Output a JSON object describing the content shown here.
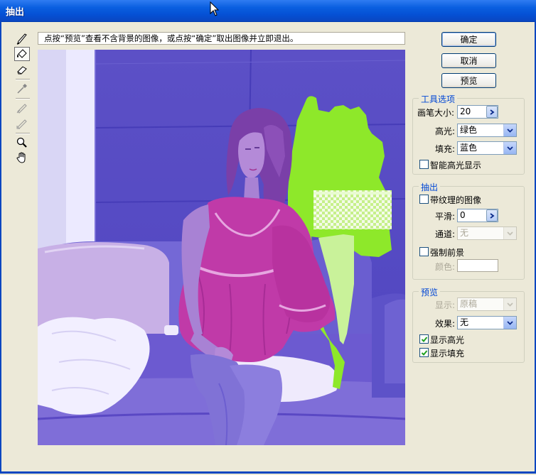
{
  "window": {
    "title": "抽出"
  },
  "instruction": "点按“预览”查看不含背景的图像，或点按“确定”取出图像并立即退出。",
  "buttons": {
    "ok": "确定",
    "cancel": "取消",
    "preview": "预览"
  },
  "tools": [
    {
      "name": "edge-highlighter-tool",
      "icon": "highlighter-icon"
    },
    {
      "name": "fill-tool",
      "icon": "paint-bucket-icon",
      "active": true
    },
    {
      "name": "eraser-tool",
      "icon": "eraser-icon"
    },
    {
      "name": "eyedropper-tool",
      "icon": "eyedropper-icon"
    },
    {
      "name": "cleanup-tool",
      "icon": "cleanup-icon"
    },
    {
      "name": "edge-touchup-tool",
      "icon": "edge-touchup-icon"
    },
    {
      "name": "zoom-tool",
      "icon": "magnifier-icon"
    },
    {
      "name": "hand-tool",
      "icon": "hand-icon"
    }
  ],
  "tool_options": {
    "legend": "工具选项",
    "brush_size_label": "画笔大小:",
    "brush_size_value": "20",
    "highlight_label": "高光:",
    "highlight_value": "绿色",
    "fill_label": "填充:",
    "fill_value": "蓝色",
    "smart_highlight_label": "智能高光显示",
    "smart_highlight_checked": false
  },
  "extraction": {
    "legend": "抽出",
    "textured_image_label": "带纹理的图像",
    "textured_image_checked": false,
    "smooth_label": "平滑:",
    "smooth_value": "0",
    "channel_label": "通道:",
    "channel_value": "无",
    "force_foreground_label": "强制前景",
    "force_foreground_checked": false,
    "color_label": "颜色:"
  },
  "preview": {
    "legend": "预览",
    "show_label": "显示:",
    "show_value": "原稿",
    "effect_label": "效果:",
    "effect_value": "无",
    "show_highlight_label": "显示高光",
    "show_highlight_checked": true,
    "show_fill_label": "显示填充",
    "show_fill_checked": true
  },
  "colors": {
    "title_bar": "#0550d4",
    "dialog_bg": "#ece9d8",
    "group_legend": "#0046d5",
    "fill_overlay": "#5a4cc8",
    "highlight_overlay": "#8ee82a"
  }
}
